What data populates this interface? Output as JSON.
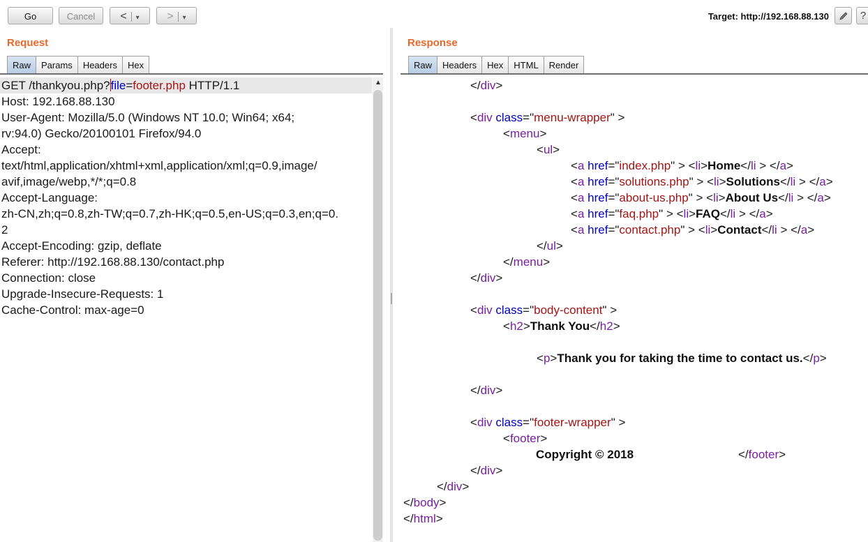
{
  "toolbar": {
    "go_label": "Go",
    "cancel_label": "Cancel",
    "back_label": "<",
    "forward_label": ">",
    "dropdown_glyph": "▾",
    "target_label": "Target: http://192.168.88.130",
    "edit_icon": "pencil-icon",
    "help_label": "?"
  },
  "request": {
    "title": "Request",
    "tabs": [
      "Raw",
      "Params",
      "Headers",
      "Hex"
    ],
    "active_tab": "Raw",
    "first_line": {
      "prefix": "GET /thankyou.php?",
      "param": "file",
      "eq": "=",
      "value": "footer.php",
      "suffix": " HTTP/1.1"
    },
    "lines": [
      "Host: 192.168.88.130",
      "User-Agent: Mozilla/5.0 (Windows NT 10.0; Win64; x64;",
      "rv:94.0) Gecko/20100101 Firefox/94.0",
      "Accept:",
      "text/html,application/xhtml+xml,application/xml;q=0.9,image/",
      "avif,image/webp,*/*;q=0.8",
      "Accept-Language:",
      "zh-CN,zh;q=0.8,zh-TW;q=0.7,zh-HK;q=0.5,en-US;q=0.3,en;q=0.",
      "2",
      "Accept-Encoding: gzip, deflate",
      "Referer: http://192.168.88.130/contact.php",
      "Connection: close",
      "Upgrade-Insecure-Requests: 1",
      "Cache-Control: max-age=0"
    ]
  },
  "response": {
    "title": "Response",
    "tabs": [
      "Raw",
      "Headers",
      "Hex",
      "HTML",
      "Render"
    ],
    "active_tab": "Raw",
    "tokens": {
      "lt": "<",
      "gt": ">",
      "lt_slash": "</",
      "eq": "=",
      "quote": "\"",
      "div": "div",
      "class": "class",
      "menu": "menu",
      "ul": "ul",
      "li": "li",
      "a": "a",
      "href": "href",
      "h2": "h2",
      "p": "p",
      "footer": "footer",
      "body": "body",
      "html": "html"
    },
    "classes": {
      "menu_wrapper": "menu-wrapper",
      "body_content": "body-content",
      "footer_wrapper": "footer-wrapper"
    },
    "menu_links": [
      {
        "href": "index.php",
        "text": "Home"
      },
      {
        "href": "solutions.php",
        "text": "Solutions"
      },
      {
        "href": "about-us.php",
        "text": "About Us"
      },
      {
        "href": "faq.php",
        "text": "FAQ"
      },
      {
        "href": "contact.php",
        "text": "Contact"
      }
    ],
    "h2_text": "Thank You",
    "p_text": "Thank you for taking the time to contact us.",
    "footer_text": "Copyright © 2018"
  }
}
